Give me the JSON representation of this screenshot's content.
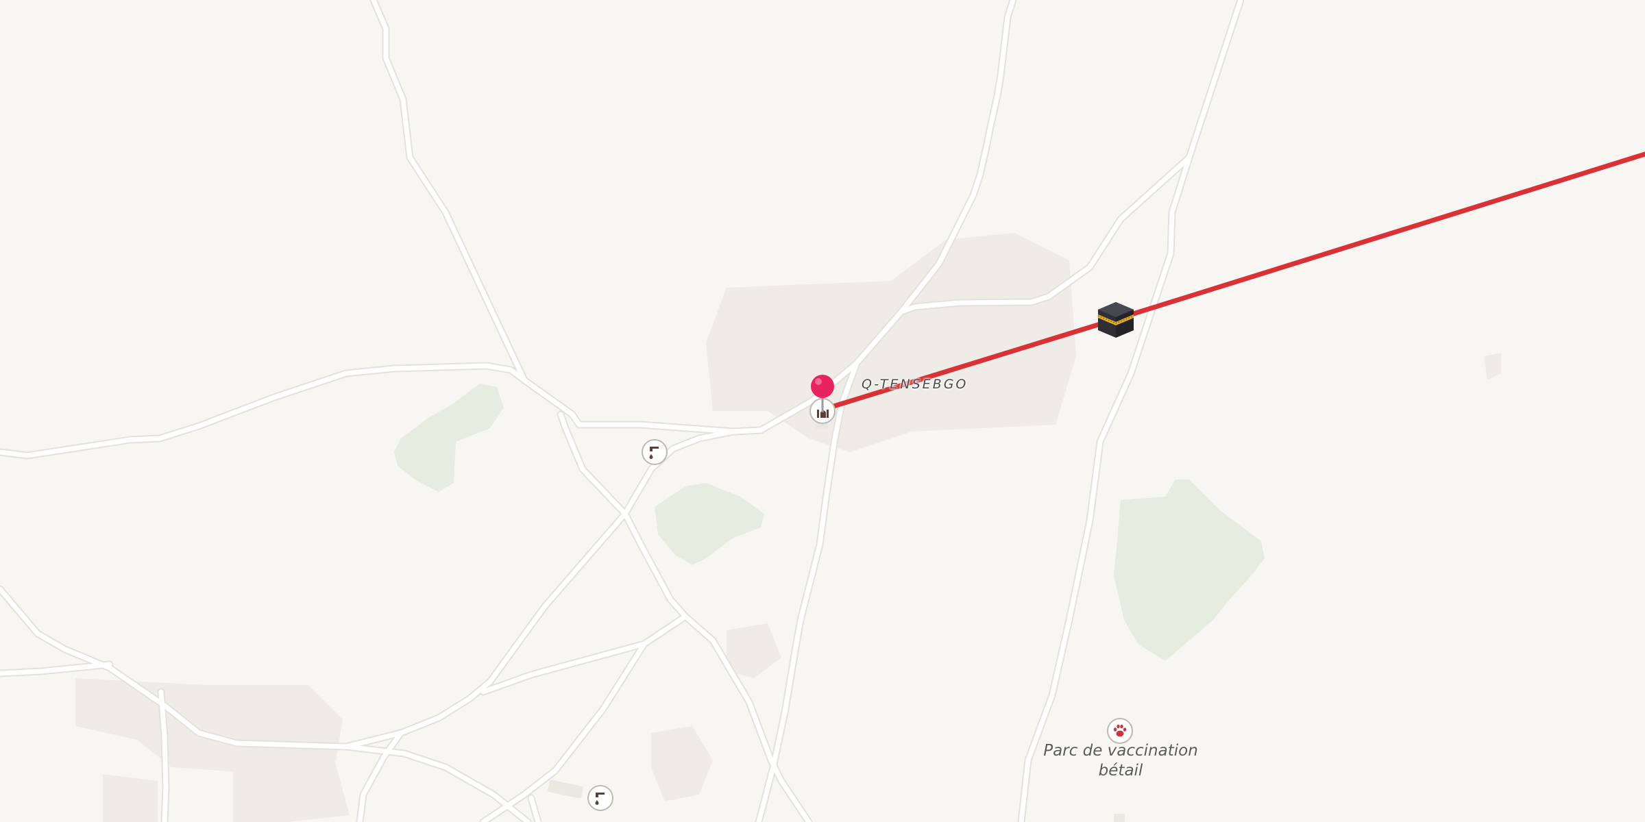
{
  "map": {
    "place_label": "Q-TENSEBGO",
    "poi_label_line1": "Parc de vaccination",
    "poi_label_line2": "bétail",
    "colors": {
      "background": "#f8f6f2",
      "road": "#ffffff",
      "road_casing": "#e4e1dc",
      "park": "#e7ece0",
      "route": "#d93236",
      "pin": "#e8245f"
    },
    "icons": {
      "water_tap": "water-tap-icon",
      "mosque": "mosque-icon",
      "veterinary": "paw-icon",
      "destination": "kaaba-icon",
      "location_pin": "map-pin-icon"
    }
  }
}
